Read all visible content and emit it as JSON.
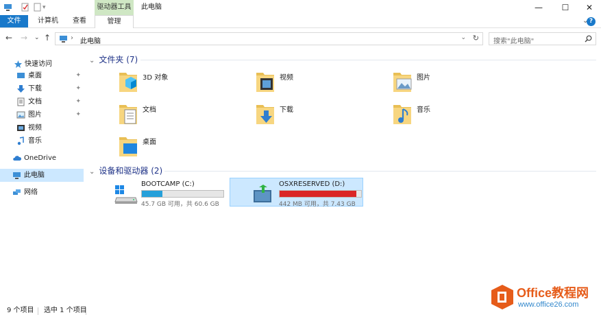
{
  "window": {
    "title": "此电脑",
    "context_tab": "驱动器工具",
    "minimize": "—",
    "maximize": "☐",
    "close": "✕"
  },
  "ribbon": {
    "tabs": [
      "文件",
      "计算机",
      "查看",
      "管理"
    ],
    "expand": "⌄",
    "help": "?"
  },
  "address": {
    "path_root": "›",
    "path": "此电脑",
    "search_placeholder": "搜索\"此电脑\""
  },
  "sidebar": {
    "quick_access": "快速访问",
    "items": [
      {
        "label": "桌面",
        "pinned": true,
        "icon": "desktop-icon"
      },
      {
        "label": "下载",
        "pinned": true,
        "icon": "download-icon"
      },
      {
        "label": "文档",
        "pinned": true,
        "icon": "document-icon"
      },
      {
        "label": "图片",
        "pinned": true,
        "icon": "picture-icon"
      },
      {
        "label": "视频",
        "pinned": false,
        "icon": "video-icon"
      },
      {
        "label": "音乐",
        "pinned": false,
        "icon": "music-icon"
      }
    ],
    "onedrive": "OneDrive",
    "this_pc": "此电脑",
    "network": "网络",
    "pin_glyph": "📌"
  },
  "main": {
    "folders_group": "文件夹 (7)",
    "folders": [
      "3D 对象",
      "视频",
      "图片",
      "文档",
      "下载",
      "音乐",
      "桌面"
    ],
    "drives_group": "设备和驱动器 (2)",
    "drives": [
      {
        "name": "BOOTCAMP (C:)",
        "info": "45.7 GB 可用，共 60.6 GB",
        "used_fraction": 0.25,
        "color": "#26a0da"
      },
      {
        "name": "OSXRESERVED (D:)",
        "info": "442 MB 可用，共 7.43 GB",
        "used_fraction": 0.94,
        "color": "#da2626"
      }
    ]
  },
  "status": {
    "count": "9 个项目",
    "selection": "选中 1 个项目"
  },
  "watermark": {
    "line1": "Office教程网",
    "line2": "www.office26.com"
  },
  "colors": {
    "accent": "#1979ca",
    "selection": "#cce8ff",
    "folder": "#f3d271"
  }
}
